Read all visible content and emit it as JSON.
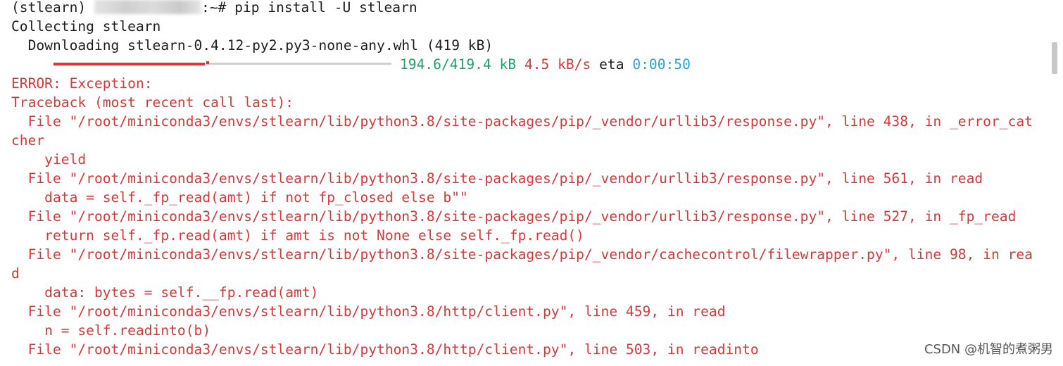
{
  "prompt": {
    "env": "(stlearn) ",
    "suffix": ":~# ",
    "command": "pip install -U stlearn"
  },
  "output": {
    "collecting": "Collecting stlearn",
    "downloading": "  Downloading stlearn-0.4.12-py2.py3-none-any.whl (419 kB)"
  },
  "progress": {
    "fraction": 0.464,
    "size": "194.6/419.4 kB",
    "speed": "4.5 kB/s",
    "eta_label": "eta",
    "eta": "0:00:50"
  },
  "traceback_lines": [
    "ERROR: Exception:",
    "Traceback (most recent call last):",
    "  File \"/root/miniconda3/envs/stlearn/lib/python3.8/site-packages/pip/_vendor/urllib3/response.py\", line 438, in _error_cat",
    "cher",
    "    yield",
    "  File \"/root/miniconda3/envs/stlearn/lib/python3.8/site-packages/pip/_vendor/urllib3/response.py\", line 561, in read",
    "    data = self._fp_read(amt) if not fp_closed else b\"\"",
    "  File \"/root/miniconda3/envs/stlearn/lib/python3.8/site-packages/pip/_vendor/urllib3/response.py\", line 527, in _fp_read",
    "    return self._fp.read(amt) if amt is not None else self._fp.read()",
    "  File \"/root/miniconda3/envs/stlearn/lib/python3.8/site-packages/pip/_vendor/cachecontrol/filewrapper.py\", line 98, in rea",
    "d",
    "    data: bytes = self.__fp.read(amt)",
    "  File \"/root/miniconda3/envs/stlearn/lib/python3.8/http/client.py\", line 459, in read",
    "    n = self.readinto(b)",
    "  File \"/root/miniconda3/envs/stlearn/lib/python3.8/http/client.py\", line 503, in readinto"
  ],
  "watermark": "CSDN @机智的煮粥男",
  "colors": {
    "error": "#d93838",
    "progress_size": "#1fa463",
    "progress_speed": "#d93838",
    "progress_eta": "#2aa4d5",
    "background": "#ffffff"
  }
}
